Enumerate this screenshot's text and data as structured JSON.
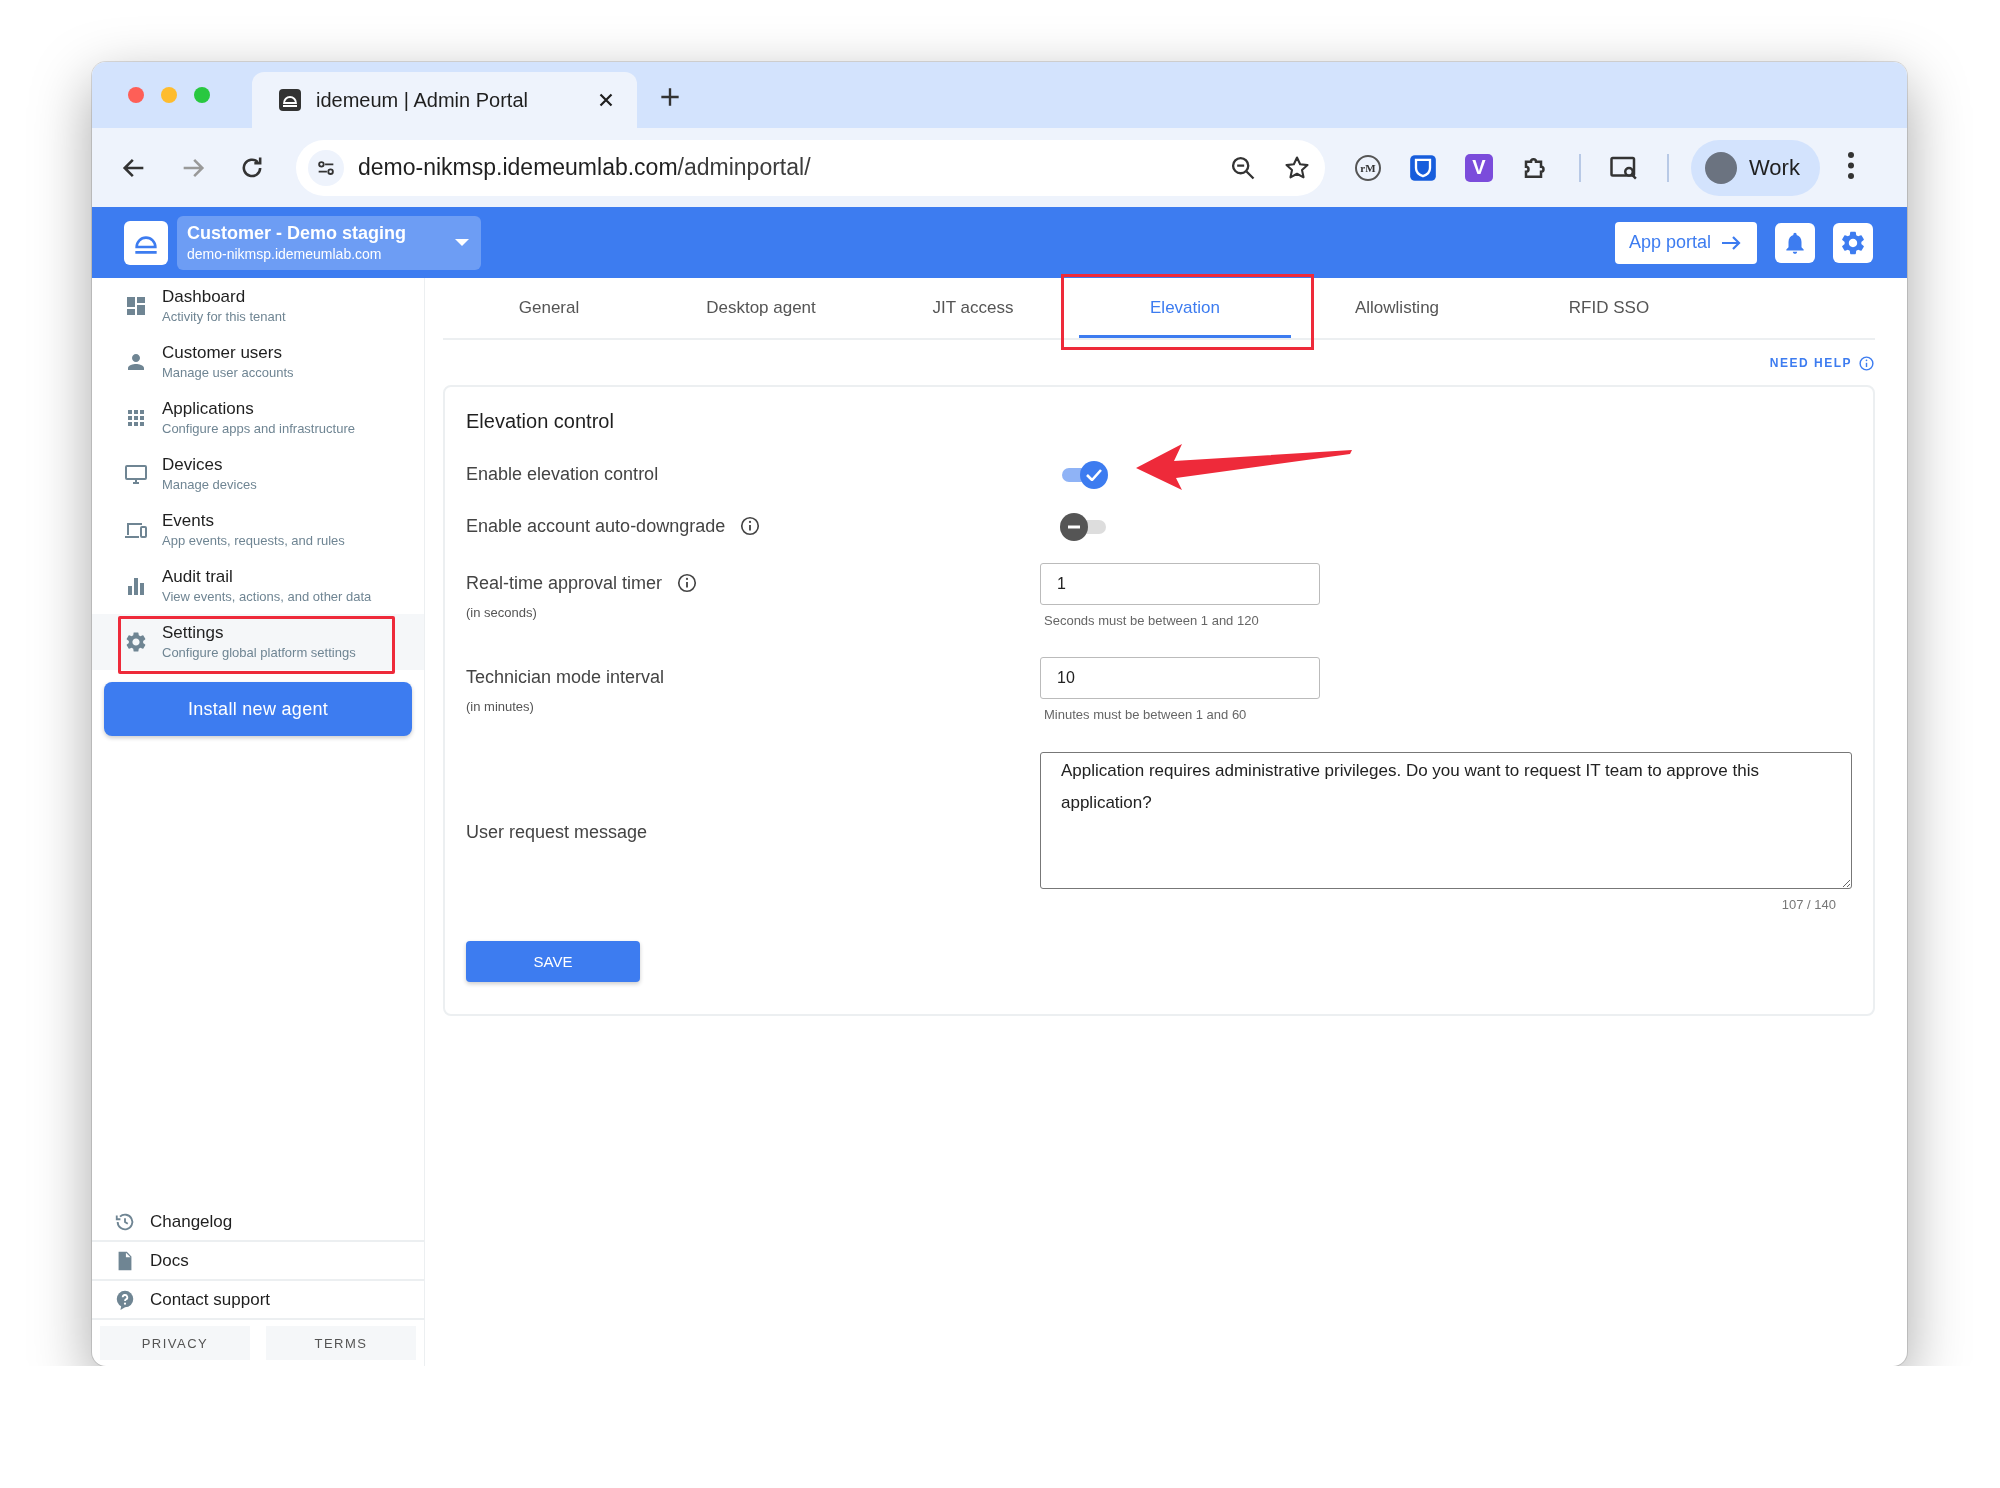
{
  "browser": {
    "tab_title": "idemeum | Admin Portal",
    "url_host": "demo-nikmsp.idemeumlab.com",
    "url_path": "/adminportal/",
    "profile": "Work",
    "extensions": [
      {
        "kind": "round",
        "label": "rM"
      },
      {
        "kind": "shield"
      },
      {
        "kind": "square",
        "label": "V"
      },
      {
        "kind": "puzzle"
      }
    ]
  },
  "header": {
    "tenant_name": "Customer - Demo staging",
    "tenant_domain": "demo-nikmsp.idemeumlab.com",
    "app_portal": "App portal"
  },
  "sidebar": {
    "items": [
      {
        "title": "Dashboard",
        "subtitle": "Activity for this tenant",
        "selected": false,
        "highlighted": false
      },
      {
        "title": "Customer users",
        "subtitle": "Manage user accounts",
        "selected": false,
        "highlighted": false
      },
      {
        "title": "Applications",
        "subtitle": "Configure apps and infrastructure",
        "selected": false,
        "highlighted": false
      },
      {
        "title": "Devices",
        "subtitle": "Manage devices",
        "selected": false,
        "highlighted": false
      },
      {
        "title": "Events",
        "subtitle": "App events, requests, and rules",
        "selected": false,
        "highlighted": false
      },
      {
        "title": "Audit trail",
        "subtitle": "View events, actions, and other data",
        "selected": false,
        "highlighted": false
      },
      {
        "title": "Settings",
        "subtitle": "Configure global platform settings",
        "selected": true,
        "highlighted": true
      }
    ],
    "install_button": "Install new agent",
    "footer_links": [
      "Changelog",
      "Docs",
      "Contact support"
    ],
    "legal_links": [
      "PRIVACY",
      "TERMS"
    ]
  },
  "tabs": [
    {
      "label": "General",
      "selected": false,
      "highlighted": false
    },
    {
      "label": "Desktop agent",
      "selected": false,
      "highlighted": false
    },
    {
      "label": "JIT access",
      "selected": false,
      "highlighted": false
    },
    {
      "label": "Elevation",
      "selected": true,
      "highlighted": true
    },
    {
      "label": "Allowlisting",
      "selected": false,
      "highlighted": false
    },
    {
      "label": "RFID SSO",
      "selected": false,
      "highlighted": false
    }
  ],
  "need_help": "NEED HELP",
  "card": {
    "title": "Elevation control",
    "settings": [
      {
        "kind": "toggle",
        "label": "Enable elevation control",
        "info": false,
        "on": true,
        "pointed": true
      },
      {
        "kind": "toggle",
        "label": "Enable account auto-downgrade",
        "info": true,
        "on": false,
        "pointed": false
      },
      {
        "kind": "number",
        "label": "Real-time approval timer",
        "unit": "(in seconds)",
        "info": true,
        "value": "1",
        "hint": "Seconds must be between 1 and 120"
      },
      {
        "kind": "number",
        "label": "Technician mode interval",
        "unit": "(in minutes)",
        "info": false,
        "value": "10",
        "hint": "Minutes must be between 1 and 60"
      },
      {
        "kind": "textarea",
        "label": "User request message",
        "value": "Application requires administrative privileges. Do you want to request IT team to approve this application?",
        "counter": "107 / 140"
      }
    ],
    "save": "SAVE"
  }
}
